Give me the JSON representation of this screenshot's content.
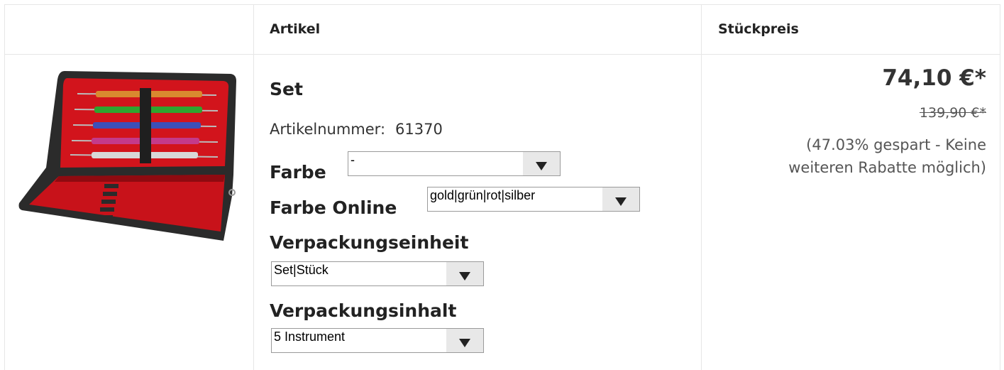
{
  "table": {
    "headers": {
      "artikel": "Artikel",
      "stueckpreis": "Stückpreis"
    }
  },
  "product": {
    "name": "Set",
    "article_number_label": "Artikelnummer:",
    "article_number": "61370",
    "image_icon": "instrument-case-image",
    "options": [
      {
        "label": "Farbe",
        "value": "-"
      },
      {
        "label": "Farbe Online",
        "value": "gold|grün|rot|silber"
      },
      {
        "label": "Verpackungseinheit",
        "value": "Set|Stück"
      },
      {
        "label": "Verpackungsinhalt",
        "value": "5 Instrument"
      }
    ]
  },
  "price": {
    "current": "74,10 €*",
    "old": "139,90 €*",
    "note": "(47.03% gespart - Keine weiteren Rabatte möglich)"
  },
  "colors": {
    "instrument_handles": [
      "#d9892f",
      "#2fa52f",
      "#3c4fb8",
      "#c43a8a",
      "#d8d8d8"
    ],
    "case_lining": "#d2141c",
    "case_shell": "#2b2b2b"
  }
}
